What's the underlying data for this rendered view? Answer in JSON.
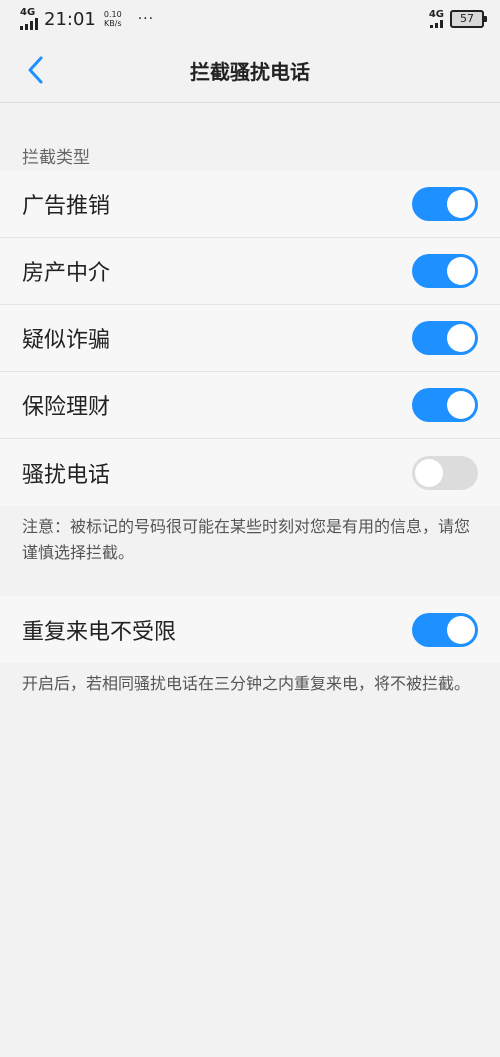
{
  "statusbar": {
    "network_left": "4G",
    "time": "21:01",
    "speed_value": "0.10",
    "speed_unit": "KB/s",
    "more": "···",
    "network_right": "4G",
    "battery": "57"
  },
  "header": {
    "title": "拦截骚扰电话"
  },
  "intercept_section": {
    "label": "拦截类型",
    "items": [
      {
        "label": "广告推销",
        "enabled": true
      },
      {
        "label": "房产中介",
        "enabled": true
      },
      {
        "label": "疑似诈骗",
        "enabled": true
      },
      {
        "label": "保险理财",
        "enabled": true
      },
      {
        "label": "骚扰电话",
        "enabled": false
      }
    ],
    "note": "注意：被标记的号码很可能在某些时刻对您是有用的信息，请您谨慎选择拦截。"
  },
  "repeat_section": {
    "label": "重复来电不受限",
    "enabled": true,
    "note": "开启后，若相同骚扰电话在三分钟之内重复来电，将不被拦截。"
  },
  "colors": {
    "accent": "#1e90ff",
    "toggle_off": "#dcdcdc",
    "background": "#f2f2f2"
  }
}
